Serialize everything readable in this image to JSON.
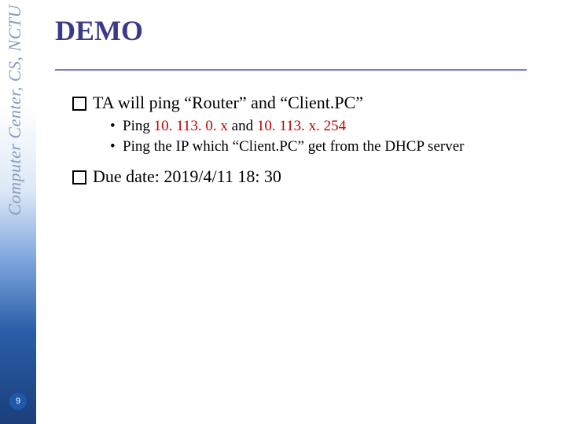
{
  "sidebar": {
    "label": "Computer Center, CS, NCTU"
  },
  "page_number": "9",
  "title": "DEMO",
  "items": {
    "q1": {
      "pre": "TA will ping “Router” and “Client.PC”",
      "sub1a": "Ping ",
      "sub1b_red": "10. 113. 0. x",
      "sub1c": " and ",
      "sub1d_red": "10. 113. x. 254",
      "sub2": "Ping the IP which “Client.PC” get from the DHCP server"
    },
    "q2": "Due date: 2019/4/11 18: 30"
  }
}
